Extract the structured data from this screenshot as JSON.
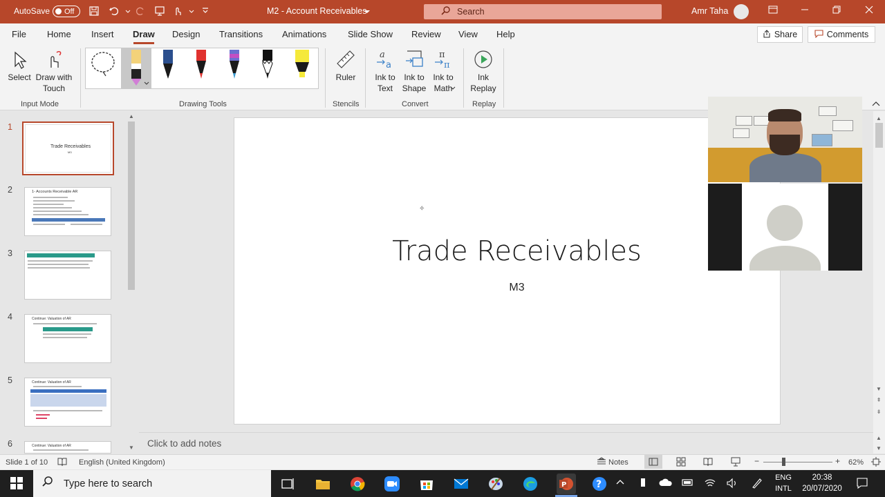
{
  "titlebar": {
    "autosave_label": "AutoSave",
    "autosave_state": "Off",
    "doc_title": "M2 - Account Receivables",
    "search_placeholder": "Search",
    "user_name": "Amr Taha"
  },
  "tabs": [
    "File",
    "Home",
    "Insert",
    "Draw",
    "Design",
    "Transitions",
    "Animations",
    "Slide Show",
    "Review",
    "View",
    "Help"
  ],
  "active_tab": "Draw",
  "share_label": "Share",
  "comments_label": "Comments",
  "ribbon": {
    "select_label": "Select",
    "draw_with_touch_label": "Draw with Touch",
    "input_mode_group": "Input Mode",
    "drawing_tools_group": "Drawing Tools",
    "ruler_label": "Ruler",
    "stencils_group": "Stencils",
    "ink_to_text_label": "Ink to Text",
    "ink_to_shape_label": "Ink to Shape",
    "ink_to_math_label": "Ink to Math",
    "convert_group": "Convert",
    "ink_replay_label": "Ink Replay",
    "replay_group": "Replay",
    "pen_colors": [
      "#1a1a1a",
      "#e0322f",
      "#3a6fc0",
      "#111111",
      "#f5e93a"
    ]
  },
  "thumbnails": [
    {
      "num": "1",
      "title": "Trade Receivables",
      "sub": "M3"
    },
    {
      "num": "2",
      "title": "1- Accounts Receivable AR"
    },
    {
      "num": "3",
      "title": ""
    },
    {
      "num": "4",
      "title": "Continue: Valuation of AR"
    },
    {
      "num": "5",
      "title": "Continue: Valuation of AR"
    },
    {
      "num": "6",
      "title": "Continue: Valuation of AR"
    }
  ],
  "slide": {
    "title": "Trade Receivables",
    "subtitle": "M3"
  },
  "notes_placeholder": "Click to add notes",
  "statusbar": {
    "slide_info": "Slide 1 of 10",
    "language": "English (United Kingdom)",
    "notes_label": "Notes",
    "zoom": "62%"
  },
  "taskbar": {
    "search_placeholder": "Type here to search",
    "lang_top": "ENG",
    "lang_bottom": "INTL",
    "time": "20:38",
    "date": "20/07/2020"
  }
}
